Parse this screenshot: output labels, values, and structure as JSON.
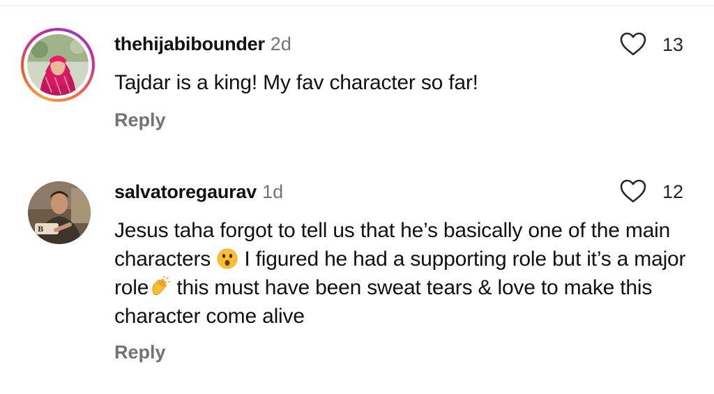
{
  "comments": [
    {
      "username": "thehijabibounder",
      "time": "2d",
      "text": "Tajdar is a king! My fav character so far!",
      "likes": "13",
      "reply_label": "Reply",
      "has_story_ring": true
    },
    {
      "username": "salvatoregaurav",
      "time": "1d",
      "text_part1": "Jesus taha forgot to tell us that he’s basically one of the main characters ",
      "text_part2": " I figured he had a supporting role but it’s a major role",
      "text_part3": "  this must have been sweat tears & love to make this character come alive",
      "emoji1": "astonished-face",
      "emoji2": "clapping-hands",
      "likes": "12",
      "reply_label": "Reply",
      "has_story_ring": false
    }
  ],
  "colors": {
    "text": "#111111",
    "secondary": "#737373",
    "background": "#ffffff"
  },
  "icons": {
    "like": "heart-outline-icon"
  }
}
